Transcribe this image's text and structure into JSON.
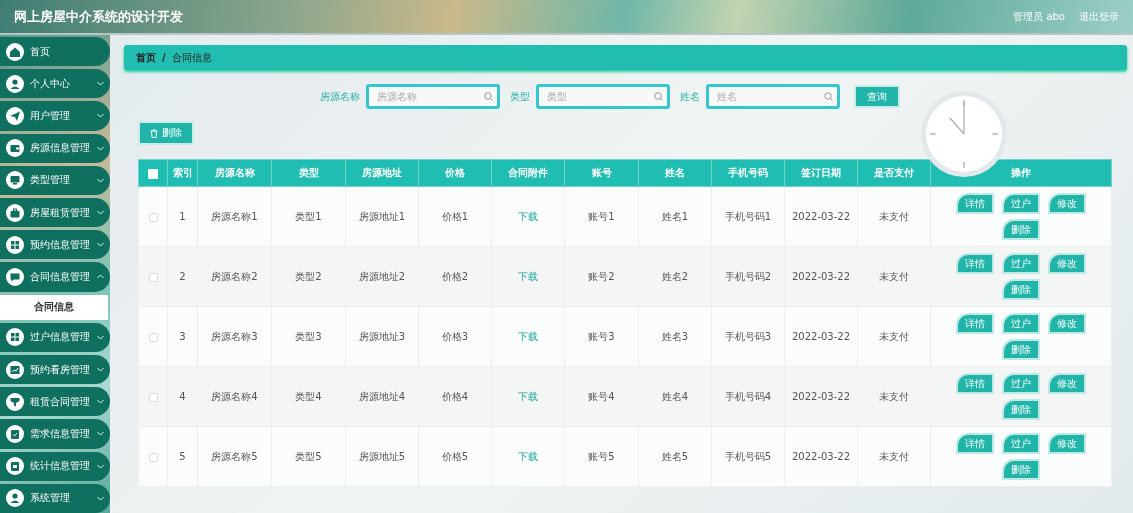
{
  "header": {
    "title": "网上房屋中介系统的设计开发",
    "user": "管理员 abo",
    "logout": "退出登录"
  },
  "sidebar": {
    "items": [
      {
        "label": "首页",
        "kind": "link"
      },
      {
        "label": "个人中心",
        "kind": "menu",
        "expanded": false
      },
      {
        "label": "用户管理",
        "kind": "menu",
        "expanded": false
      },
      {
        "label": "房源信息管理",
        "kind": "menu",
        "expanded": false
      },
      {
        "label": "类型管理",
        "kind": "menu",
        "expanded": false
      },
      {
        "label": "房屋租赁管理",
        "kind": "menu",
        "expanded": false
      },
      {
        "label": "预约信息管理",
        "kind": "menu",
        "expanded": false
      },
      {
        "label": "合同信息管理",
        "kind": "menu",
        "expanded": true,
        "children": [
          {
            "label": "合同信息",
            "selected": true
          }
        ]
      },
      {
        "label": "过户信息管理",
        "kind": "menu",
        "expanded": false
      },
      {
        "label": "预约看房管理",
        "kind": "menu",
        "expanded": false
      },
      {
        "label": "租赁合同管理",
        "kind": "menu",
        "expanded": false
      },
      {
        "label": "需求信息管理",
        "kind": "menu",
        "expanded": false
      },
      {
        "label": "统计信息管理",
        "kind": "menu",
        "expanded": false
      },
      {
        "label": "系统管理",
        "kind": "menu",
        "expanded": false
      }
    ]
  },
  "breadcrumb": {
    "items": [
      "首页",
      "合同信息"
    ],
    "separator": "/"
  },
  "search": {
    "fields": [
      {
        "label": "房源名称",
        "placeholder": "房源名称"
      },
      {
        "label": "类型",
        "placeholder": "类型"
      },
      {
        "label": "姓名",
        "placeholder": "姓名"
      }
    ],
    "button": "查询"
  },
  "toolbar": {
    "delete_button": "删除"
  },
  "table": {
    "select_all_checked": false,
    "columns": [
      {
        "label": "索引",
        "kind": "text"
      },
      {
        "label": "房源名称",
        "kind": "text"
      },
      {
        "label": "类型",
        "kind": "text"
      },
      {
        "label": "房源地址",
        "kind": "text"
      },
      {
        "label": "价格",
        "kind": "text"
      },
      {
        "label": "合同附件",
        "kind": "link"
      },
      {
        "label": "账号",
        "kind": "text"
      },
      {
        "label": "姓名",
        "kind": "text"
      },
      {
        "label": "手机号码",
        "kind": "text"
      },
      {
        "label": "签订日期",
        "kind": "text"
      },
      {
        "label": "是否支付",
        "kind": "text"
      },
      {
        "label": "操作",
        "kind": "actions"
      }
    ],
    "rows": [
      {
        "checked": false,
        "cells": [
          "1",
          "房源名称1",
          "类型1",
          "房源地址1",
          "价格1",
          "下载",
          "账号1",
          "姓名1",
          "手机号码1",
          "2022-03-22",
          "未支付"
        ],
        "actions": [
          "详情",
          "过户",
          "修改",
          "删除"
        ]
      },
      {
        "checked": false,
        "cells": [
          "2",
          "房源名称2",
          "类型2",
          "房源地址2",
          "价格2",
          "下载",
          "账号2",
          "姓名2",
          "手机号码2",
          "2022-03-22",
          "未支付"
        ],
        "actions": [
          "详情",
          "过户",
          "修改",
          "删除"
        ]
      },
      {
        "checked": false,
        "cells": [
          "3",
          "房源名称3",
          "类型3",
          "房源地址3",
          "价格3",
          "下载",
          "账号3",
          "姓名3",
          "手机号码3",
          "2022-03-22",
          "未支付"
        ],
        "actions": [
          "详情",
          "过户",
          "修改",
          "删除"
        ]
      },
      {
        "checked": false,
        "cells": [
          "4",
          "房源名称4",
          "类型4",
          "房源地址4",
          "价格4",
          "下载",
          "账号4",
          "姓名4",
          "手机号码4",
          "2022-03-22",
          "未支付"
        ],
        "actions": [
          "详情",
          "过户",
          "修改",
          "删除"
        ]
      },
      {
        "checked": false,
        "cells": [
          "5",
          "房源名称5",
          "类型5",
          "房源地址5",
          "价格5",
          "下载",
          "账号5",
          "姓名5",
          "手机号码5",
          "2022-03-22",
          "未支付"
        ],
        "actions": [
          "详情",
          "过户",
          "修改",
          "删除"
        ]
      }
    ]
  }
}
